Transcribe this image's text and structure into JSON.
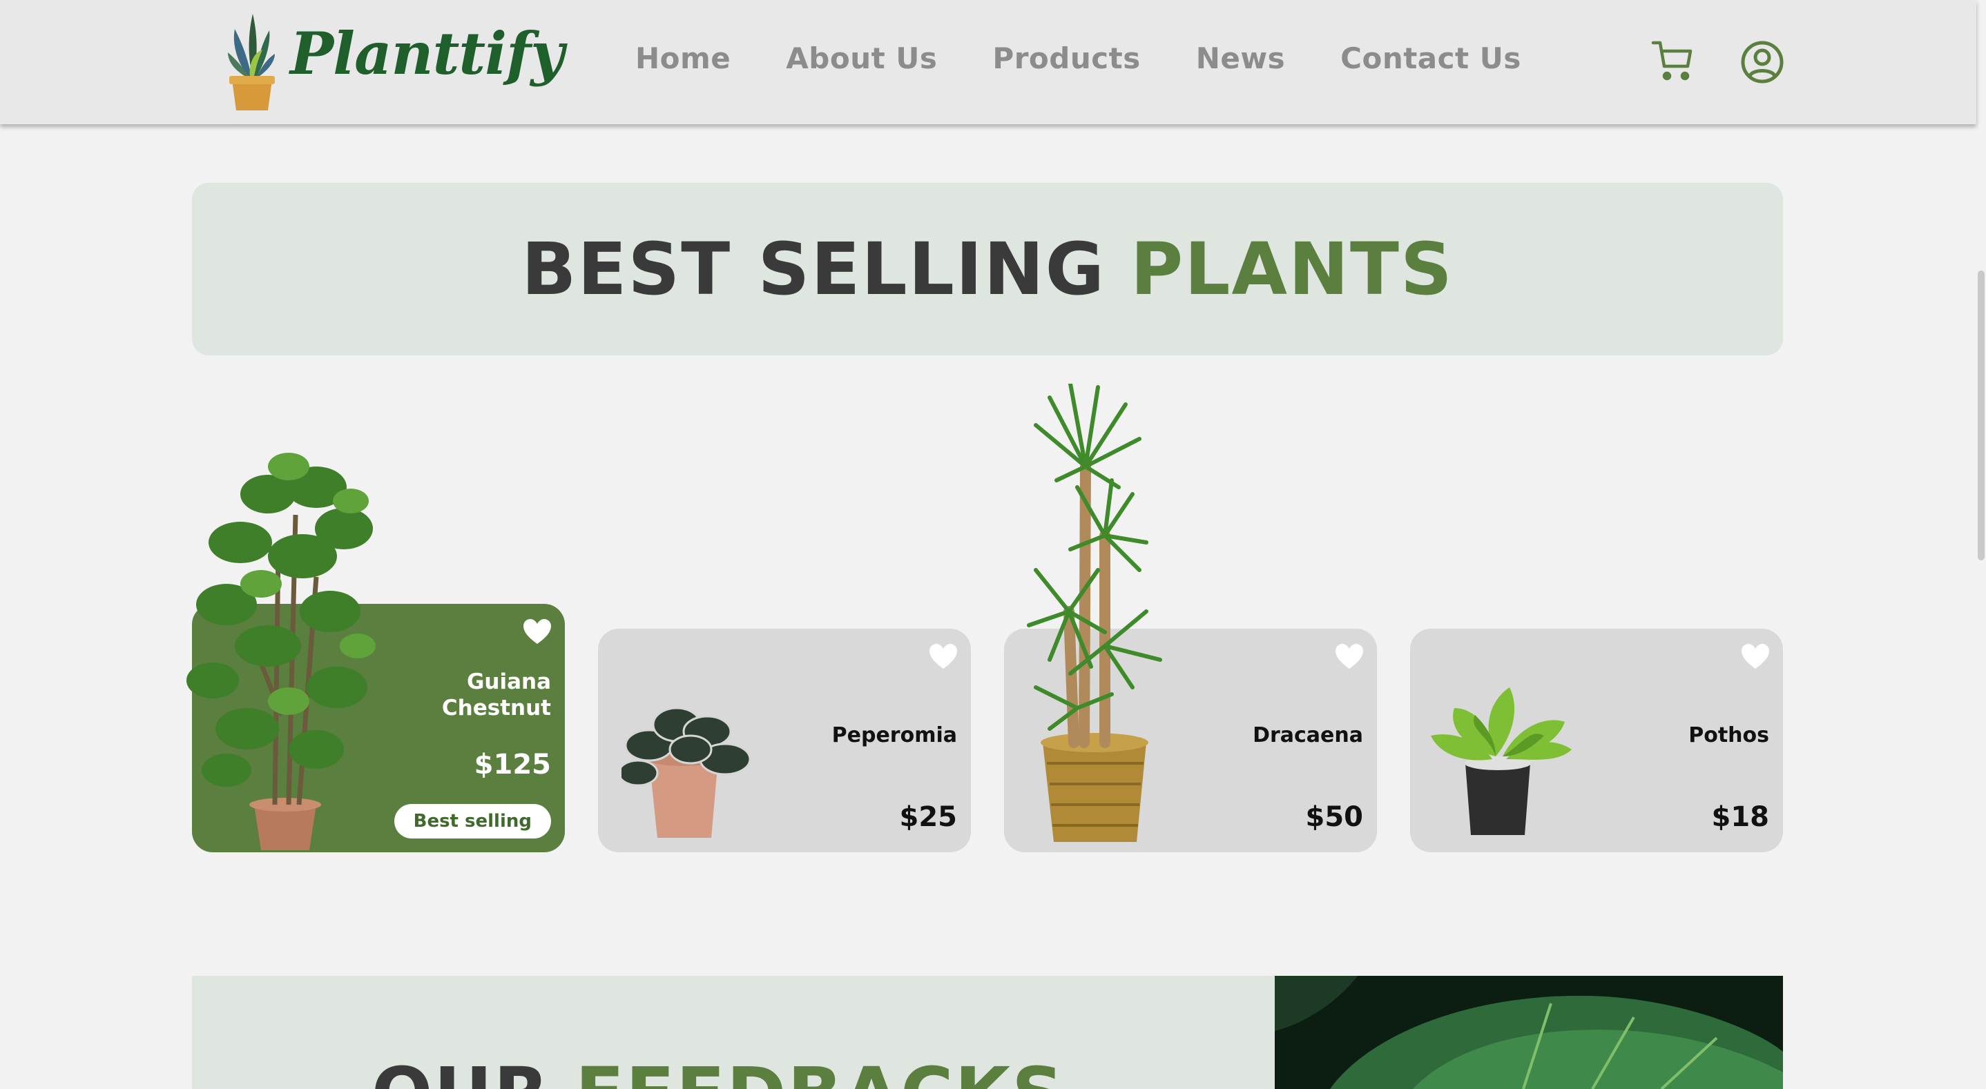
{
  "brand": {
    "name": "Planttify"
  },
  "nav": {
    "items": [
      {
        "label": "Home"
      },
      {
        "label": "About Us"
      },
      {
        "label": "Products"
      },
      {
        "label": "News"
      },
      {
        "label": "Contact Us"
      }
    ],
    "icons": [
      "cart-icon",
      "user-account-icon"
    ]
  },
  "section_title": {
    "main": "BEST SELLING",
    "accent": "PLANTS"
  },
  "products": [
    {
      "name": "Guiana Chestnut",
      "price": "$125",
      "badge": "Best selling",
      "featured": true
    },
    {
      "name": "Peperomia",
      "price": "$25",
      "featured": false
    },
    {
      "name": "Dracaena",
      "price": "$50",
      "featured": false
    },
    {
      "name": "Pothos",
      "price": "$18",
      "featured": false
    }
  ],
  "feedback": {
    "main": "OUR",
    "accent": "FEEDBACKS"
  },
  "colors": {
    "brand_green": "#5b7f3e",
    "dark_green": "#1f5f2c",
    "nav_gray": "#8c8c8c",
    "banner_bg": "#dfe5df"
  }
}
